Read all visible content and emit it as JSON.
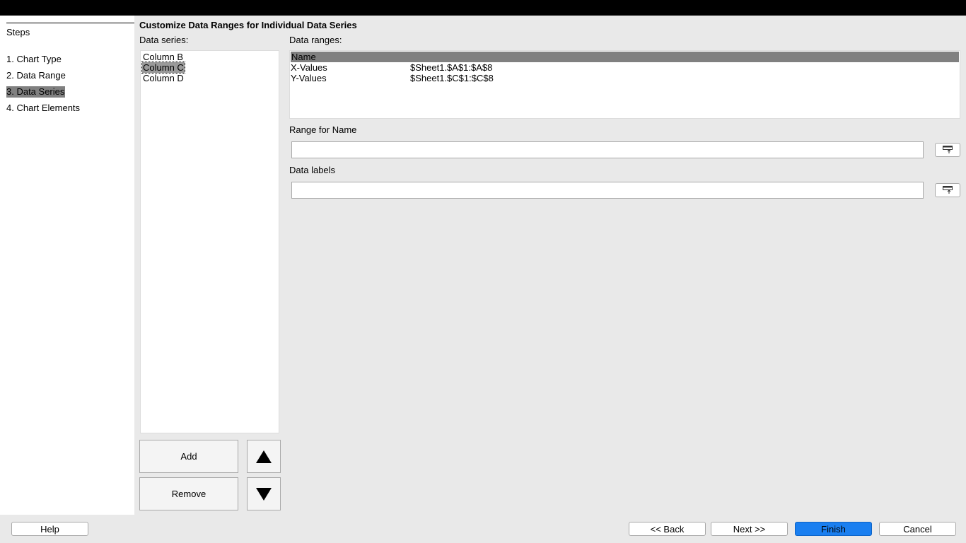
{
  "steps": {
    "title": "Steps",
    "items": [
      {
        "label": "1. Chart Type"
      },
      {
        "label": "2. Data Range"
      },
      {
        "label": "3. Data Series"
      },
      {
        "label": "4. Chart Elements"
      }
    ],
    "active_index": 2
  },
  "main": {
    "heading": "Customize Data Ranges for Individual Data Series",
    "series_label": "Data series:",
    "series": [
      "Column B",
      "Column C",
      "Column D"
    ],
    "selected_series": "Column C",
    "ranges_label": "Data ranges:",
    "ranges_table": {
      "header": "Name",
      "rows": [
        {
          "role": "X-Values",
          "range": "$Sheet1.$A$1:$A$8"
        },
        {
          "role": "Y-Values",
          "range": "$Sheet1.$C$1:$C$8"
        }
      ]
    },
    "range_for_name_label": "Range for Name",
    "range_for_name_value": "",
    "data_labels_label": "Data labels",
    "data_labels_value": ""
  },
  "buttons": {
    "add": "Add",
    "remove": "Remove",
    "help": "Help",
    "back": "<< Back",
    "next": "Next >>",
    "finish": "Finish",
    "cancel": "Cancel"
  },
  "icons": {
    "move_up": "arrow-up-icon",
    "move_down": "arrow-down-icon",
    "shrink": "shrink-dialog-icon"
  },
  "colors": {
    "accent": "#1a7ff0",
    "selection": "#808080"
  }
}
